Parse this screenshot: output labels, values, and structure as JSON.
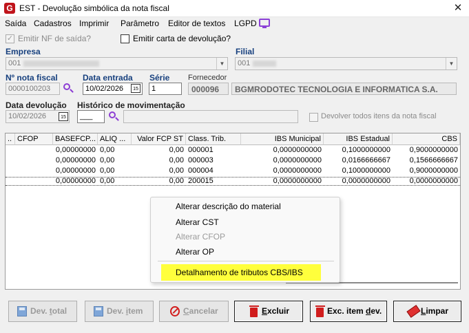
{
  "window": {
    "title": "EST - Devolução simbólica da nota fiscal",
    "app_icon_letter": "G",
    "close_glyph": "✕"
  },
  "menu": {
    "items": [
      "Saída",
      "Cadastros",
      "Imprimir",
      "Parâmetro",
      "Editor de textos",
      "LGPD"
    ]
  },
  "options": {
    "emitir_nf": {
      "label": "Emitir NF de saída?",
      "checked": true,
      "enabled": false
    },
    "emitir_carta": {
      "label": "Emitir carta de devolução?",
      "checked": false,
      "enabled": true
    },
    "devolver_todos": {
      "label": "Devolver todos itens da nota fiscal",
      "checked": false,
      "enabled": false
    }
  },
  "form": {
    "empresa": {
      "label": "Empresa",
      "value": "001"
    },
    "filial": {
      "label": "Filial",
      "value": "001"
    },
    "nota_fiscal": {
      "label": "Nº nota fiscal",
      "value": "0000100203"
    },
    "data_entrada": {
      "label": "Data entrada",
      "value": "10/02/2026"
    },
    "serie": {
      "label": "Série",
      "value": "1"
    },
    "fornecedor": {
      "label": "Fornecedor",
      "code": "000096",
      "name": "BGMRODOTEC TECNOLOGIA E INFORMATICA S.A."
    },
    "data_devolucao": {
      "label": "Data devolução",
      "value": "10/02/2026"
    },
    "historico": {
      "label": "Histórico de movimentação",
      "code": "___",
      "description": ""
    },
    "calendar_glyph": "15"
  },
  "grid": {
    "columns": [
      "..",
      "CFOP",
      "BASEFCP...",
      "ALIQ ...",
      "Valor FCP ST",
      "Class. Trib.",
      "IBS Municipal",
      "IBS Estadual",
      "CBS"
    ],
    "rows": [
      [
        "",
        "",
        "0,00000000",
        "0,00",
        "0,00",
        "000001",
        "0,0000000000",
        "0,1000000000",
        "0,9000000000"
      ],
      [
        "",
        "",
        "0,00000000",
        "0,00",
        "0,00",
        "000003",
        "0,0000000000",
        "0,0166666667",
        "0,1566666667"
      ],
      [
        "",
        "",
        "0,00000000",
        "0,00",
        "0,00",
        "000004",
        "0,0000000000",
        "0,1000000000",
        "0,9000000000"
      ],
      [
        "",
        "",
        "0,00000000",
        "0,00",
        "0,00",
        "200015",
        "0,0000000000",
        "0,0000000000",
        "0,0000000000"
      ]
    ],
    "selected_row": 3
  },
  "context_menu": {
    "items": [
      {
        "label": "Alterar descrição do material",
        "enabled": true
      },
      {
        "label": "Alterar CST",
        "enabled": true
      },
      {
        "label": "Alterar CFOP",
        "enabled": false
      },
      {
        "label": "Alterar OP",
        "enabled": true
      },
      {
        "label": "Detalhamento de tributos CBS/IBS",
        "enabled": true,
        "highlighted": true
      }
    ],
    "highlight_color": "#ffff3c"
  },
  "buttons": {
    "dev_total": {
      "prefix": "Dev. ",
      "hotkey": "t",
      "rest": "otal",
      "enabled": false
    },
    "dev_item": {
      "prefix": "Dev. ",
      "hotkey": "i",
      "rest": "tem",
      "enabled": false
    },
    "cancelar": {
      "prefix": "",
      "hotkey": "C",
      "rest": "ancelar",
      "enabled": false
    },
    "excluir": {
      "prefix": "",
      "hotkey": "E",
      "rest": "xcluir",
      "enabled": true
    },
    "exc_item_dev": {
      "prefix": "Exc. item ",
      "hotkey": "d",
      "rest": "ev.",
      "enabled": true
    },
    "limpar": {
      "prefix": "",
      "hotkey": "L",
      "rest": "impar",
      "enabled": true
    }
  },
  "colors": {
    "label_blue": "#17407e",
    "icon_purple": "#8c3cd4",
    "danger_red": "#d01c1c",
    "brand_red": "#c0141b"
  }
}
